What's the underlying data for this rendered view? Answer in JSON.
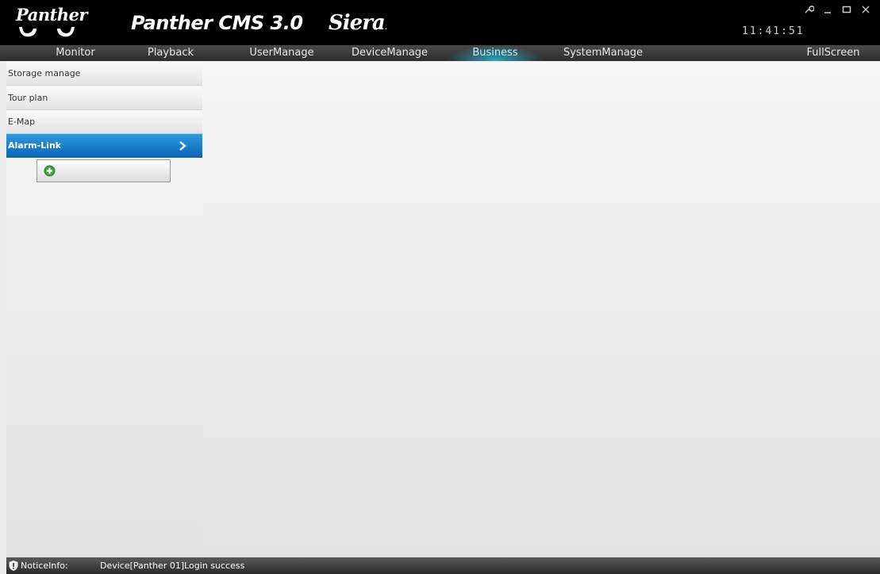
{
  "titlebar": {
    "logo_text": "Panther",
    "app_title": "Panther CMS 3.0",
    "brand": "Siera",
    "clock": "11:41:51"
  },
  "menu": {
    "items": [
      {
        "label": "Monitor"
      },
      {
        "label": "Playback"
      },
      {
        "label": "UserManage"
      },
      {
        "label": "DeviceManage"
      },
      {
        "label": "Business",
        "active": true
      },
      {
        "label": "SystemManage"
      },
      {
        "label": "FullScreen"
      }
    ]
  },
  "sidebar": {
    "items": [
      {
        "label": "Storage manage"
      },
      {
        "label": "Tour plan"
      },
      {
        "label": "E-Map"
      },
      {
        "label": "Alarm-Link",
        "active": true
      }
    ],
    "add_button": {
      "icon": "add-icon",
      "color": "#2f8a2f"
    }
  },
  "status": {
    "label": "NoticeInfo:",
    "message": "Device[Panther 01]Login success"
  },
  "colors": {
    "accent_blue": "#0a64b4",
    "menu_active_glow": "#28bedc",
    "titlebar_bg": "#000000"
  }
}
